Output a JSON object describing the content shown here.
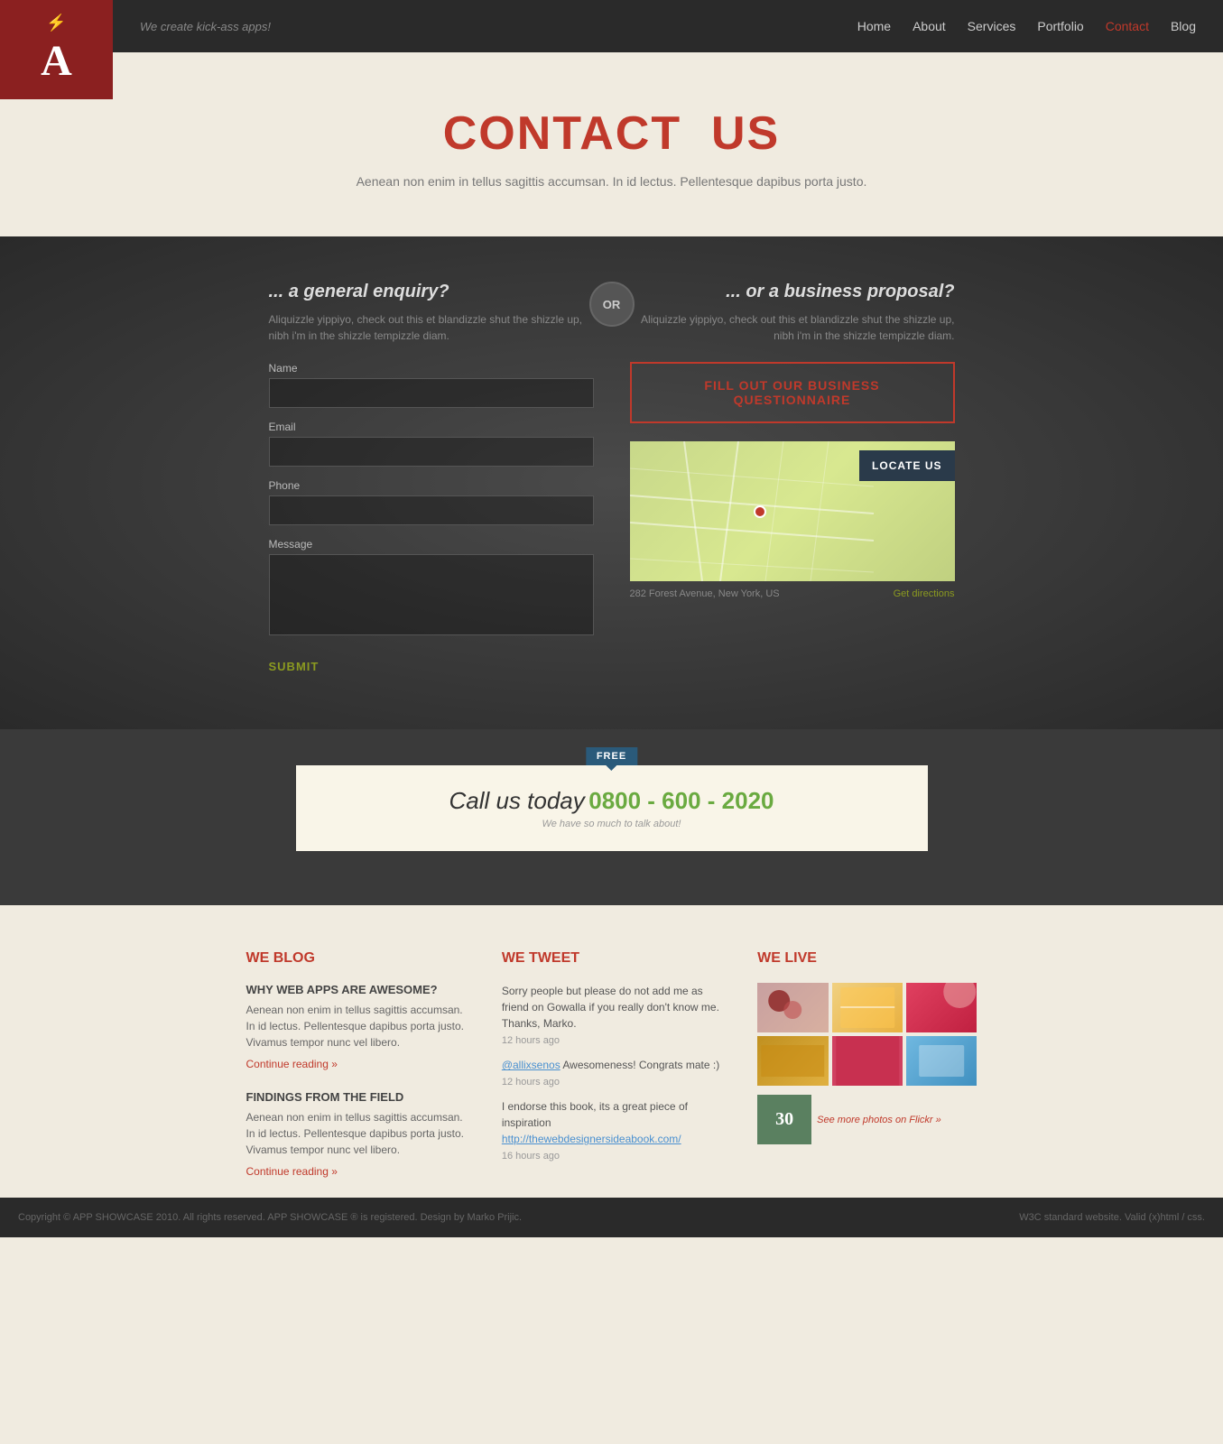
{
  "nav": {
    "tagline": "We create kick-ass apps!",
    "logo_letter": "A",
    "bolt": "⚡",
    "links": [
      {
        "label": "Home",
        "href": "#",
        "active": false
      },
      {
        "label": "About",
        "href": "#",
        "active": false
      },
      {
        "label": "Services",
        "href": "#",
        "active": false
      },
      {
        "label": "Portfolio",
        "href": "#",
        "active": false
      },
      {
        "label": "Contact",
        "href": "#",
        "active": true
      },
      {
        "label": "Blog",
        "href": "#",
        "active": false
      }
    ]
  },
  "hero": {
    "title_dark": "CONTACT",
    "title_red": "US",
    "description": "Aenean non enim in tellus sagittis accumsan. In id lectus.\nPellentesque dapibus porta justo."
  },
  "contact": {
    "or_label": "OR",
    "left": {
      "title": "... a general enquiry?",
      "description": "Aliquizzle yippiyo, check out this et blandizzle shut the shizzle up, nibh i'm in the shizzle tempizzle diam.",
      "name_label": "Name",
      "email_label": "Email",
      "phone_label": "Phone",
      "message_label": "Message",
      "submit_label": "SUBMIT"
    },
    "right": {
      "title": "... or a business proposal?",
      "description": "Aliquizzle yippiyo, check out this et blandizzle shut the shizzle up, nibh i'm in the shizzle tempizzle diam.",
      "questionnaire_btn": "FILL OUT OUR BUSINESS QUESTIONNAIRE",
      "locate_btn": "LOCATE US",
      "address": "282 Forest Avenue, New York, US",
      "directions_link": "Get directions"
    }
  },
  "call": {
    "free_badge": "FREE",
    "call_text": "Call us today",
    "call_number": "0800 - 600 - 2020",
    "call_sub": "We have so much to talk about!"
  },
  "footer": {
    "blog": {
      "heading_we": "WE",
      "heading_word": "BLOG",
      "posts": [
        {
          "title": "WHY WEB APPS ARE AWESOME?",
          "text": "Aenean non enim in tellus sagittis accumsan. In id lectus. Pellentesque dapibus porta justo. Vivamus tempor nunc vel libero.",
          "link": "Continue reading »"
        },
        {
          "title": "FINDINGS FROM THE FIELD",
          "text": "Aenean non enim in tellus sagittis accumsan. In id lectus. Pellentesque dapibus porta justo. Vivamus tempor nunc vel libero.",
          "link": "Continue reading »"
        }
      ]
    },
    "tweet": {
      "heading_we": "WE",
      "heading_word": "TWEET",
      "tweets": [
        {
          "text": "Sorry people but please do not add me as friend on Gowalla if you really don't know me. Thanks, Marko.",
          "time": "12 hours ago",
          "link": null
        },
        {
          "prefix": "@allixsenos",
          "text": " Awesomeness! Congrats mate :)",
          "time": "12 hours ago",
          "link": "@allixsenos"
        },
        {
          "text": "I endorse this book, its a great piece of inspiration",
          "time": "16 hours ago",
          "link_text": "http://thewebdesignersideabook.com/",
          "link_url": "#"
        }
      ]
    },
    "live": {
      "heading_we": "WE",
      "heading_word": "LIVE",
      "flickr_link": "See more photos on Flickr »"
    },
    "copyright": "Copyright © APP SHOWCASE 2010. All rights reserved. APP SHOWCASE ® is registered. Design by Marko Prijic.",
    "valid": "W3C standard website. Valid (x)html / css."
  }
}
